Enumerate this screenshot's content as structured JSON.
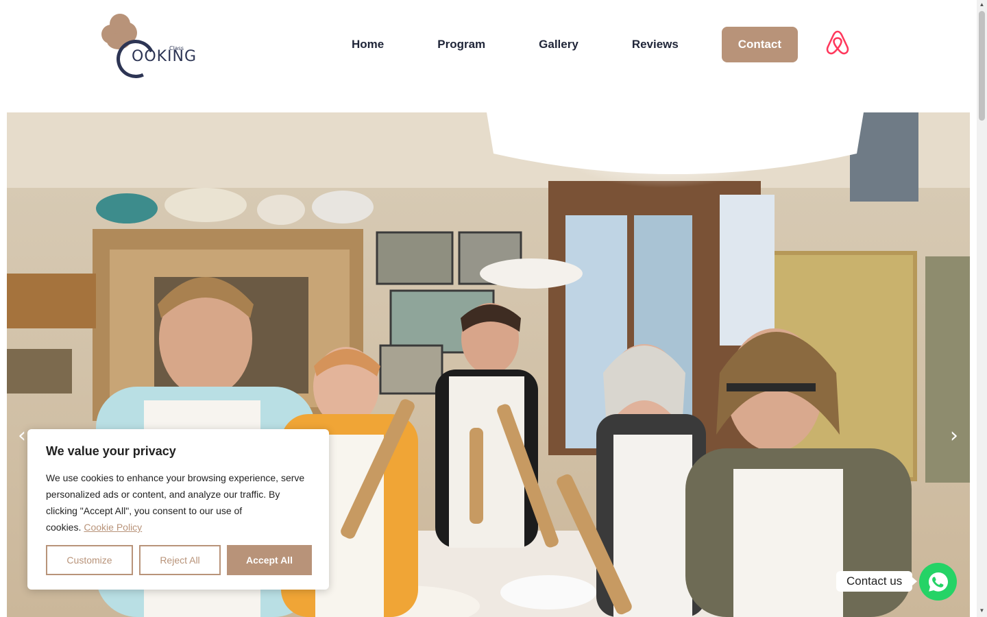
{
  "brand": {
    "logo_word": "OOKING",
    "logo_small": "Class",
    "accent_color": "#b89379",
    "dark_color": "#2d3554"
  },
  "nav": {
    "items": [
      {
        "label": "Home"
      },
      {
        "label": "Program"
      },
      {
        "label": "Gallery"
      },
      {
        "label": "Reviews"
      }
    ],
    "contact_label": "Contact",
    "airbnb_icon": "airbnb-icon"
  },
  "hero": {
    "image_alt": "cooking-class-photo",
    "prev_icon": "chevron-left-icon",
    "next_icon": "chevron-right-icon"
  },
  "cookie_banner": {
    "title": "We value your privacy",
    "text": "We use cookies to enhance your browsing experience, serve personalized ads or content, and analyze our traffic. By clicking \"Accept All\", you consent to our use of cookies.",
    "policy_link": "Cookie Policy",
    "customize_label": "Customize",
    "reject_label": "Reject All",
    "accept_label": "Accept All"
  },
  "whatsapp": {
    "label": "Contact us",
    "icon": "whatsapp-icon",
    "color": "#25d366"
  }
}
